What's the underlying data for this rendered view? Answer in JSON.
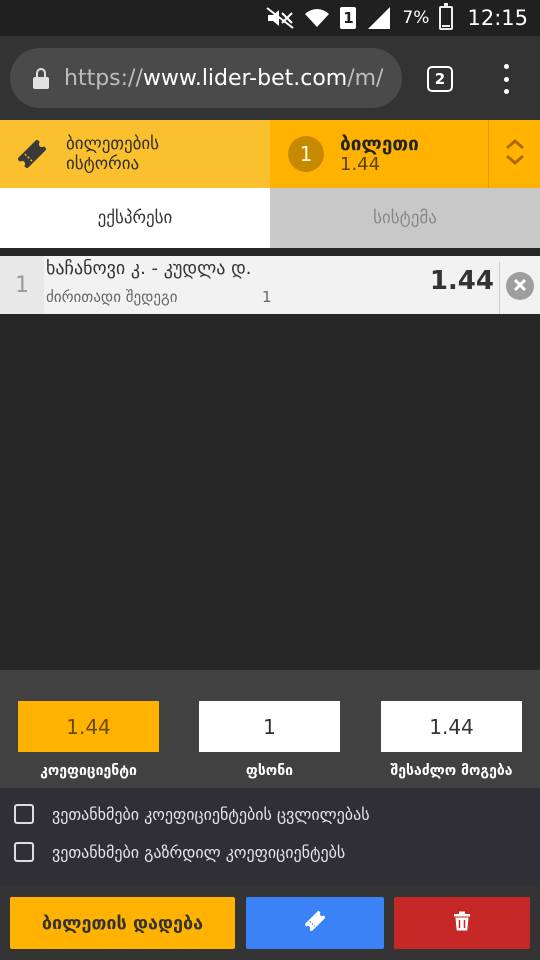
{
  "status_bar": {
    "battery": "7%",
    "time": "12:15",
    "sim_slot": "1",
    "icons": [
      "mute-icon",
      "wifi-icon",
      "sim-icon",
      "signal-icon",
      "battery-icon"
    ]
  },
  "browser": {
    "url_scheme": "https://",
    "url_host": "www.lider-bet.com",
    "url_path": "/m/",
    "tab_count": "2"
  },
  "ticket_header": {
    "history_label": "ბილეთების ისტორია",
    "ticket_count": "1",
    "ticket_title": "ბილეთი",
    "ticket_odds": "1.44"
  },
  "modes": {
    "express": "ექსპრესი",
    "system": "სისტემა",
    "active": "express"
  },
  "bets": [
    {
      "index": "1",
      "match": "ხაჩანოვი კ. - კუდლა დ.",
      "market": "ძირითადი შედეგი",
      "outcome": "1",
      "odd": "1.44"
    }
  ],
  "summary": {
    "odds_value": "1.44",
    "odds_label": "კოეფიციენტი",
    "stake_value": "1",
    "stake_label": "ფსონი",
    "win_value": "1.44",
    "win_label": "შესაძლო მოგება"
  },
  "options": {
    "accept_changes": "ვეთანხმები კოეფიციენტების ცვლილებას",
    "accept_boosted": "ვეთანხმები გაზრდილ კოეფიციენტებს"
  },
  "actions": {
    "place_label": "ბილეთის დადება"
  },
  "colors": {
    "accent": "#ffb300",
    "accent_light": "#fbc02d",
    "save": "#3b82f6",
    "delete": "#c62828"
  }
}
